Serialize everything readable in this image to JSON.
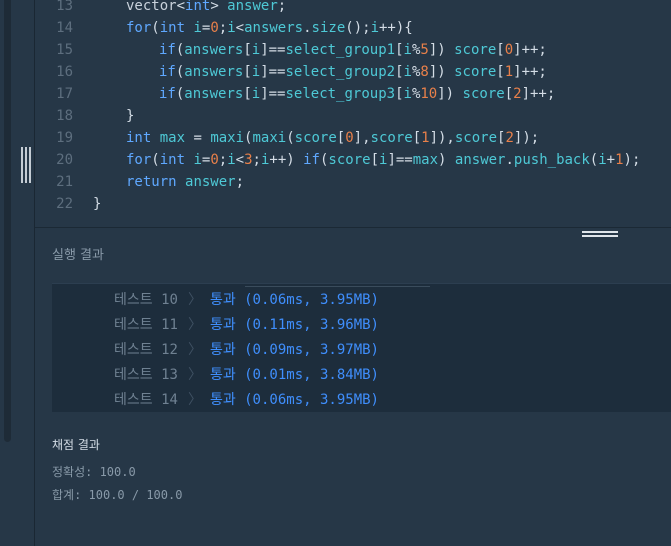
{
  "editor": {
    "lines": [
      {
        "num": "13",
        "tokens": [
          [
            "ty",
            "vector"
          ],
          [
            "op",
            "<"
          ],
          [
            "kw",
            "int"
          ],
          [
            "op",
            "> "
          ],
          [
            "id",
            "answer"
          ],
          [
            "op",
            ";"
          ]
        ],
        "indent": 1
      },
      {
        "num": "14",
        "tokens": [
          [
            "kw",
            "for"
          ],
          [
            "op",
            "("
          ],
          [
            "kw",
            "int"
          ],
          [
            "op",
            " "
          ],
          [
            "id",
            "i"
          ],
          [
            "op",
            "="
          ],
          [
            "nm",
            "0"
          ],
          [
            "op",
            ";"
          ],
          [
            "id",
            "i"
          ],
          [
            "op",
            "<"
          ],
          [
            "id",
            "answers"
          ],
          [
            "op",
            "."
          ],
          [
            "id",
            "size"
          ],
          [
            "op",
            "();"
          ],
          [
            "id",
            "i"
          ],
          [
            "op",
            "++){"
          ]
        ],
        "indent": 1
      },
      {
        "num": "15",
        "tokens": [
          [
            "kw",
            "if"
          ],
          [
            "op",
            "("
          ],
          [
            "id",
            "answers"
          ],
          [
            "op",
            "["
          ],
          [
            "id",
            "i"
          ],
          [
            "op",
            "]=="
          ],
          [
            "id",
            "select_group1"
          ],
          [
            "op",
            "["
          ],
          [
            "id",
            "i"
          ],
          [
            "op",
            "%"
          ],
          [
            "nm",
            "5"
          ],
          [
            "op",
            "]) "
          ],
          [
            "id",
            "score"
          ],
          [
            "op",
            "["
          ],
          [
            "nm",
            "0"
          ],
          [
            "op",
            "]++;"
          ]
        ],
        "indent": 2
      },
      {
        "num": "16",
        "tokens": [
          [
            "kw",
            "if"
          ],
          [
            "op",
            "("
          ],
          [
            "id",
            "answers"
          ],
          [
            "op",
            "["
          ],
          [
            "id",
            "i"
          ],
          [
            "op",
            "]=="
          ],
          [
            "id",
            "select_group2"
          ],
          [
            "op",
            "["
          ],
          [
            "id",
            "i"
          ],
          [
            "op",
            "%"
          ],
          [
            "nm",
            "8"
          ],
          [
            "op",
            "]) "
          ],
          [
            "id",
            "score"
          ],
          [
            "op",
            "["
          ],
          [
            "nm",
            "1"
          ],
          [
            "op",
            "]++;"
          ]
        ],
        "indent": 2
      },
      {
        "num": "17",
        "tokens": [
          [
            "kw",
            "if"
          ],
          [
            "op",
            "("
          ],
          [
            "id",
            "answers"
          ],
          [
            "op",
            "["
          ],
          [
            "id",
            "i"
          ],
          [
            "op",
            "]=="
          ],
          [
            "id",
            "select_group3"
          ],
          [
            "op",
            "["
          ],
          [
            "id",
            "i"
          ],
          [
            "op",
            "%"
          ],
          [
            "nm",
            "10"
          ],
          [
            "op",
            "]) "
          ],
          [
            "id",
            "score"
          ],
          [
            "op",
            "["
          ],
          [
            "nm",
            "2"
          ],
          [
            "op",
            "]++;"
          ]
        ],
        "indent": 2
      },
      {
        "num": "18",
        "tokens": [
          [
            "op",
            "}"
          ]
        ],
        "indent": 1
      },
      {
        "num": "19",
        "tokens": [
          [
            "kw",
            "int"
          ],
          [
            "op",
            " "
          ],
          [
            "id",
            "max"
          ],
          [
            "op",
            " = "
          ],
          [
            "id",
            "maxi"
          ],
          [
            "op",
            "("
          ],
          [
            "id",
            "maxi"
          ],
          [
            "op",
            "("
          ],
          [
            "id",
            "score"
          ],
          [
            "op",
            "["
          ],
          [
            "nm",
            "0"
          ],
          [
            "op",
            "],"
          ],
          [
            "id",
            "score"
          ],
          [
            "op",
            "["
          ],
          [
            "nm",
            "1"
          ],
          [
            "op",
            "]),"
          ],
          [
            "id",
            "score"
          ],
          [
            "op",
            "["
          ],
          [
            "nm",
            "2"
          ],
          [
            "op",
            "]);"
          ]
        ],
        "indent": 1
      },
      {
        "num": "20",
        "tokens": [
          [
            "kw",
            "for"
          ],
          [
            "op",
            "("
          ],
          [
            "kw",
            "int"
          ],
          [
            "op",
            " "
          ],
          [
            "id",
            "i"
          ],
          [
            "op",
            "="
          ],
          [
            "nm",
            "0"
          ],
          [
            "op",
            ";"
          ],
          [
            "id",
            "i"
          ],
          [
            "op",
            "<"
          ],
          [
            "nm",
            "3"
          ],
          [
            "op",
            ";"
          ],
          [
            "id",
            "i"
          ],
          [
            "op",
            "++) "
          ],
          [
            "kw",
            "if"
          ],
          [
            "op",
            "("
          ],
          [
            "id",
            "score"
          ],
          [
            "op",
            "["
          ],
          [
            "id",
            "i"
          ],
          [
            "op",
            "]=="
          ],
          [
            "id",
            "max"
          ],
          [
            "op",
            ") "
          ],
          [
            "id",
            "answer"
          ],
          [
            "op",
            "."
          ],
          [
            "id",
            "push_back"
          ],
          [
            "op",
            "("
          ],
          [
            "id",
            "i"
          ],
          [
            "op",
            "+"
          ],
          [
            "nm",
            "1"
          ],
          [
            "op",
            ");"
          ]
        ],
        "indent": 1
      },
      {
        "num": "21",
        "tokens": [
          [
            "kw",
            "return"
          ],
          [
            "op",
            " "
          ],
          [
            "id",
            "answer"
          ],
          [
            "op",
            ";"
          ]
        ],
        "indent": 1
      },
      {
        "num": "22",
        "tokens": [
          [
            "op",
            "}"
          ]
        ],
        "indent": 0
      }
    ]
  },
  "results": {
    "title": "실행 결과",
    "tests": [
      {
        "name": "테스트 10",
        "status": "통과 (0.06ms, 3.95MB)"
      },
      {
        "name": "테스트 11",
        "status": "통과 (0.11ms, 3.96MB)"
      },
      {
        "name": "테스트 12",
        "status": "통과 (0.09ms, 3.97MB)"
      },
      {
        "name": "테스트 13",
        "status": "통과 (0.01ms, 3.84MB)"
      },
      {
        "name": "테스트 14",
        "status": "통과 (0.06ms, 3.95MB)"
      }
    ],
    "chevron": "〉"
  },
  "grading": {
    "title": "채점 결과",
    "accuracy": "정확성: 100.0",
    "total": "합계: 100.0 / 100.0"
  },
  "colors": {
    "background": "#263747",
    "pass": "#3f8efc",
    "keyword": "#5fa8ff",
    "identifier": "#4ec9d6",
    "number": "#e8804a"
  }
}
